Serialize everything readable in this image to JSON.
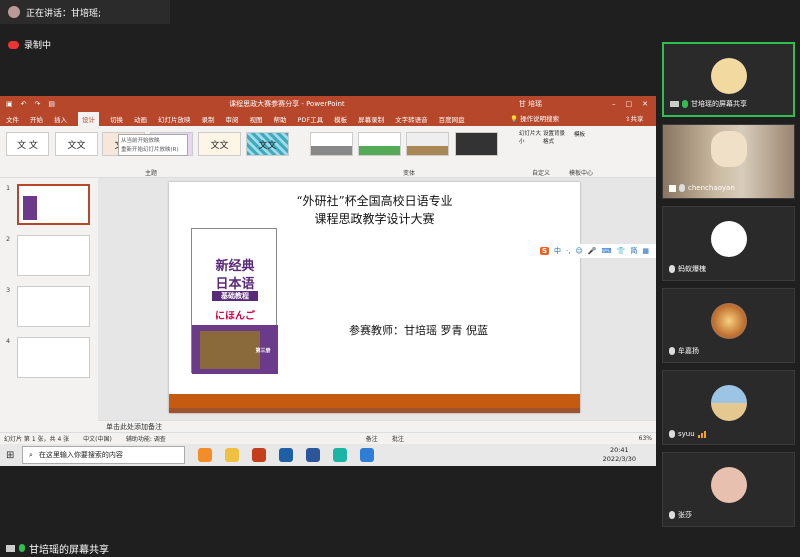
{
  "meeting": {
    "speaking": "正在讲话：甘培瑶;",
    "recording": "录制中",
    "share_label": "甘培瑶的屏幕共享"
  },
  "ppt": {
    "window_title": "课程思政大赛参赛分享 - PowerPoint",
    "user": "甘 培瑶",
    "share_btn": "共享",
    "menu": [
      "文件",
      "开始",
      "插入",
      "设计",
      "切换",
      "动画",
      "幻灯片放映",
      "录制",
      "审阅",
      "视图",
      "帮助",
      "PDF工具",
      "模板",
      "屏幕录制",
      "文字转语音",
      "百度网盘"
    ],
    "menu_active": "设计",
    "tell_me": "操作说明搜索",
    "theme_sample": "文文",
    "theme_sample_alt": "文 文",
    "groups": {
      "themes": "主题",
      "variants": "变体",
      "customize": "自定义",
      "template": "模板中心"
    },
    "custom_btns": [
      "幻灯片大小",
      "设置背景格式",
      "模板"
    ],
    "tooltip": [
      "从当前开始放映",
      "重新开始幻灯片放映(R)"
    ],
    "slide": {
      "title1": "“外研社”杯全国高校日语专业",
      "title2": "课程思政教学设计大赛",
      "book_title1": "新经典",
      "book_title2": "日本语",
      "book_sub": "基础教程",
      "book_kana": "にほんご",
      "book_vol": "第三册",
      "teachers": "参赛教师：甘培瑶  罗青  倪蓝"
    },
    "thumb_nums": [
      "1",
      "2",
      "3",
      "4"
    ],
    "notes": "单击此处添加备注",
    "status": {
      "slide_count": "幻灯片 第 1 张，共 4 张",
      "lang": "中文(中国)",
      "accessibility": "辅助功能: 调查",
      "notes_btn": "备注",
      "comments_btn": "批注",
      "zoom": "63%"
    },
    "ime": [
      "中",
      "·,",
      "☺",
      "🎤",
      "⌨",
      "👕",
      "简",
      "▦"
    ]
  },
  "taskbar": {
    "search_placeholder": "在这里输入你要搜索的内容",
    "time": "20:41",
    "date": "2022/3/30"
  },
  "participants": [
    {
      "name": "甘培瑶的屏幕共享",
      "color": "#f1d9a0",
      "active": true,
      "mic": "on"
    },
    {
      "name": "chenchaoyan",
      "color": "#7a6450",
      "video": true,
      "mic": "off"
    },
    {
      "name": "蚂蚁爆槐",
      "color": "#ffffff",
      "mic": "off"
    },
    {
      "name": "牟嘉扬",
      "color": "#d9a26a",
      "mic": "off"
    },
    {
      "name": "syuu",
      "color": "#7fa8c8",
      "mic": "off"
    },
    {
      "name": "张莎",
      "color": "#e8c0b0",
      "mic": "off"
    }
  ],
  "colors": {
    "accent": "#b7472a",
    "orange": "#c55a11",
    "green": "#2fbf4f"
  }
}
